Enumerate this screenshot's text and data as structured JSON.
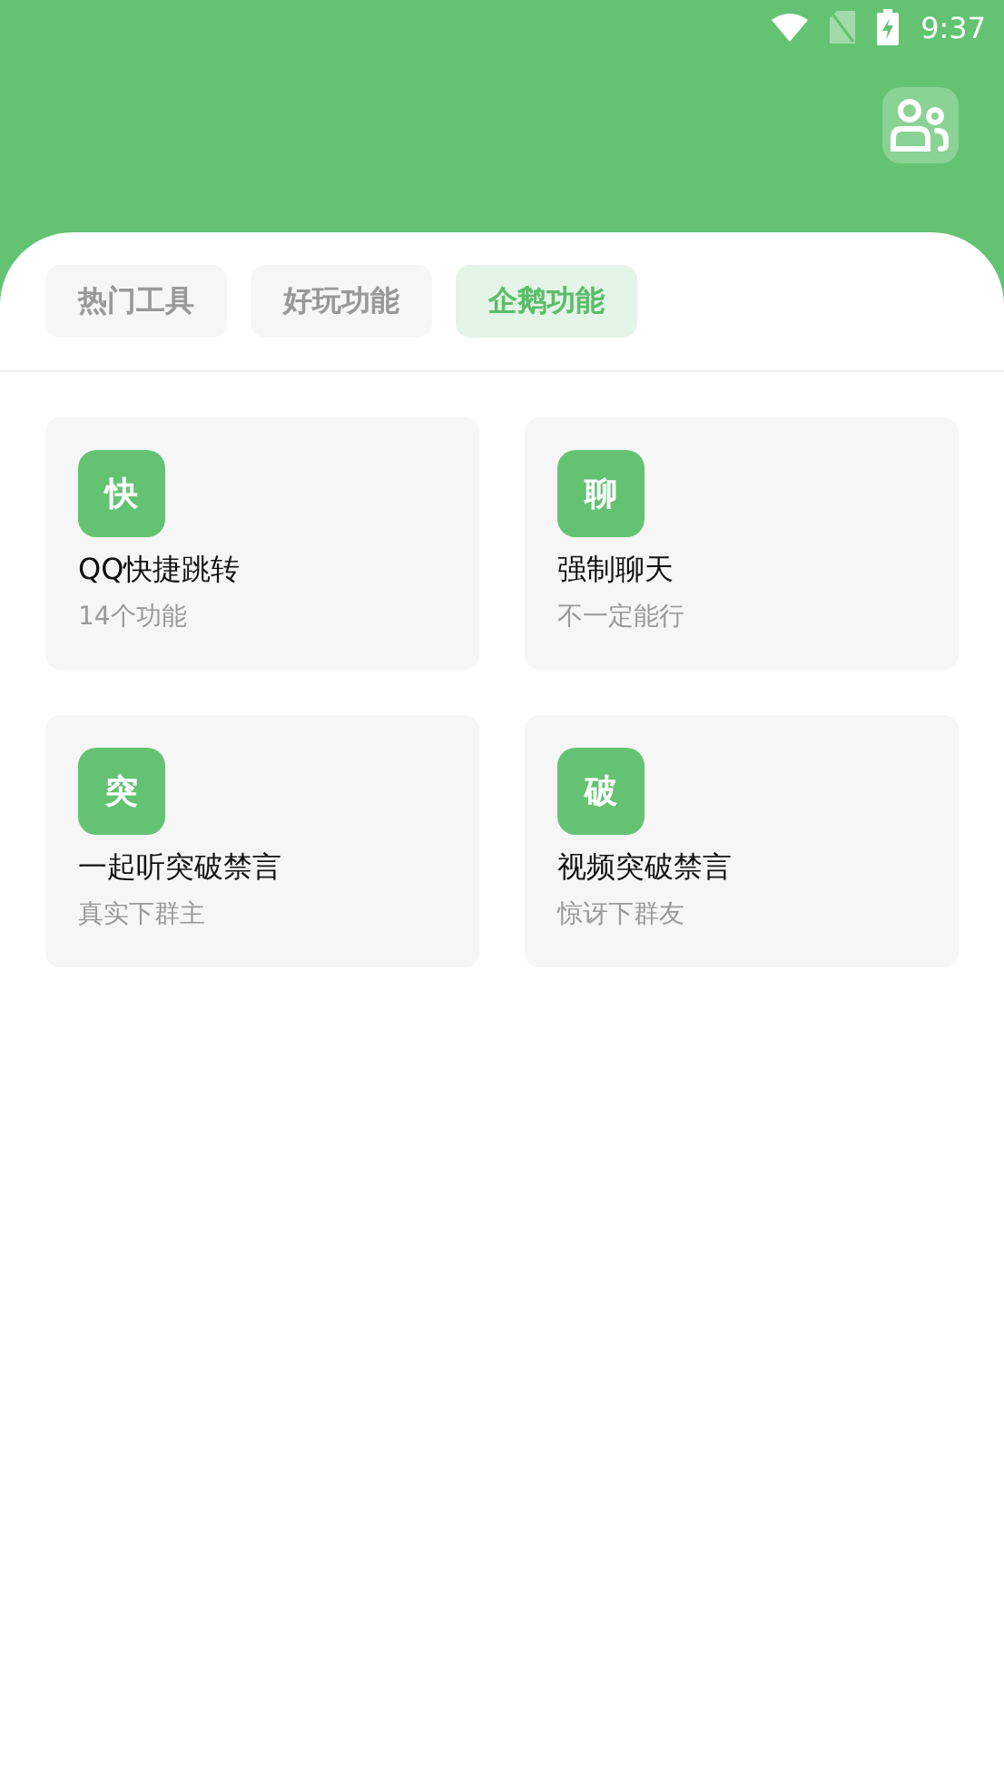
{
  "status_bar": {
    "time": "9:37"
  },
  "tabs": [
    {
      "label": "热门工具",
      "selected": false
    },
    {
      "label": "好玩功能",
      "selected": false
    },
    {
      "label": "企鹅功能",
      "selected": true
    }
  ],
  "cards": [
    {
      "glyph": "快",
      "title": "QQ快捷跳转",
      "subtitle": "14个功能"
    },
    {
      "glyph": "聊",
      "title": "强制聊天",
      "subtitle": "不一定能行"
    },
    {
      "glyph": "突",
      "title": "一起听突破禁言",
      "subtitle": "真实下群主"
    },
    {
      "glyph": "破",
      "title": "视频突破禁言",
      "subtitle": "惊讶下群友"
    }
  ]
}
